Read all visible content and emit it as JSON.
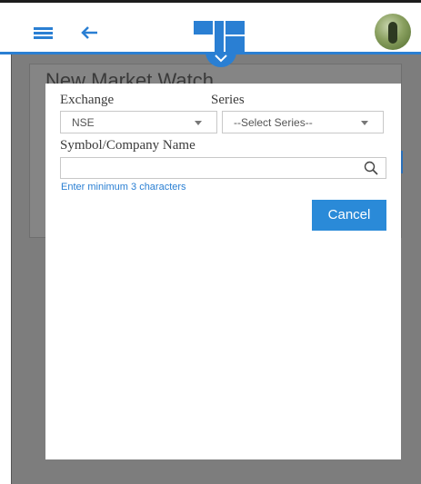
{
  "header": {
    "menu_icon": "hamburger-icon",
    "back_icon": "back-arrow-icon",
    "logo_icon": "brand-logo",
    "avatar_icon": "user-avatar",
    "collapse_icon": "chevron-down-icon",
    "accent_color": "#2a7fd3"
  },
  "background": {
    "card_title": "New Market Watch"
  },
  "modal": {
    "exchange": {
      "label": "Exchange",
      "selected": "NSE"
    },
    "series": {
      "label": "Series",
      "selected": "--Select Series--"
    },
    "symbol": {
      "label": "Symbol/Company Name",
      "value": "",
      "hint": "Enter minimum 3 characters"
    },
    "cancel_label": "Cancel"
  }
}
